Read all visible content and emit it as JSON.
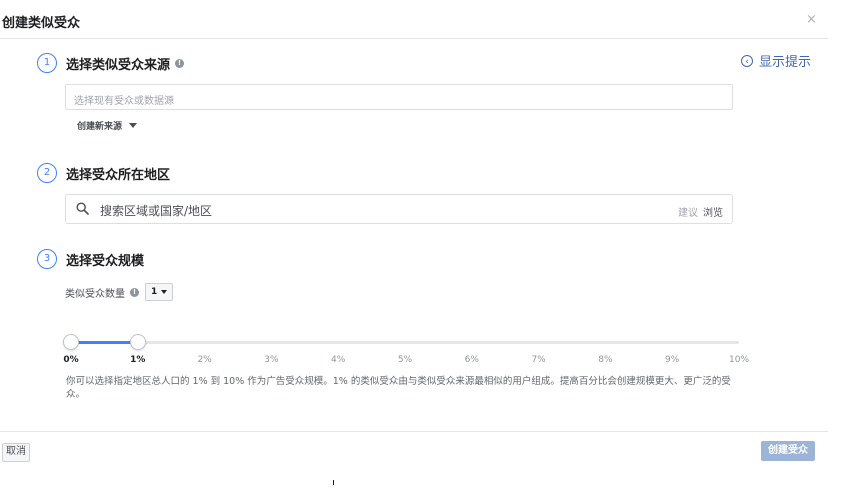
{
  "dialog": {
    "title": "创建类似受众",
    "close_label": "×",
    "hint_label": "显示提示",
    "hint_icon_glyph": "‹"
  },
  "step1": {
    "number": "1",
    "title": "选择类似受众来源",
    "info_glyph": "!",
    "input_placeholder": "选择现有受众或数据源",
    "create_source_label": "创建新来源"
  },
  "step2": {
    "number": "2",
    "title": "选择受众所在地区",
    "search_placeholder": "搜索区域或国家/地区",
    "suggest_label": "建议",
    "browse_label": "浏览"
  },
  "step3": {
    "number": "3",
    "title": "选择受众规模",
    "count_label": "类似受众数量",
    "count_value": "1",
    "slider": {
      "range_start": 0,
      "range_end": 1,
      "max": 10,
      "ticks": [
        "0%",
        "1%",
        "2%",
        "3%",
        "4%",
        "5%",
        "6%",
        "7%",
        "8%",
        "9%",
        "10%"
      ]
    },
    "description": "你可以选择指定地区总人口的 1% 到 10% 作为广告受众规模。1% 的类似受众由与类似受众来源最相似的用户组成。提高百分比会创建规模更大、更广泛的受众。"
  },
  "footer": {
    "cancel_label": "取消",
    "create_label": "创建受众"
  },
  "colors": {
    "accent": "#4080ff",
    "link": "#4267b2",
    "disabled_button": "#9cb4d8"
  }
}
